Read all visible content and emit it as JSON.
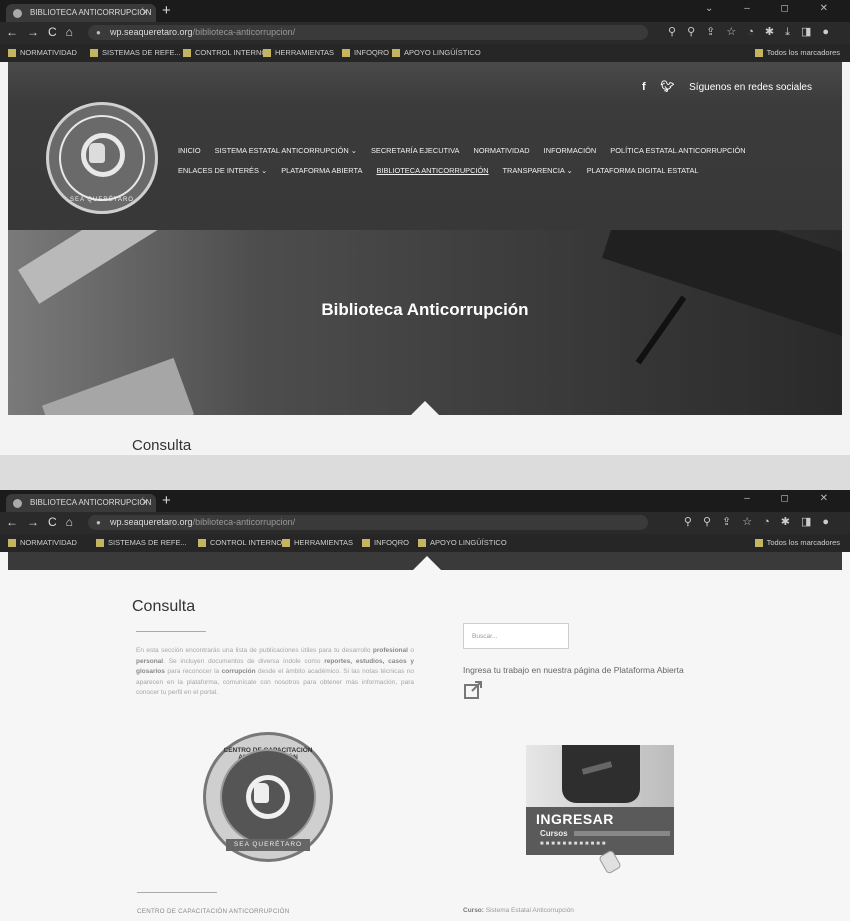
{
  "shot1": {
    "tab_title": "BIBLIOTECA ANTICORRUPCIÓN",
    "tab_close": "×",
    "new_tab": "+",
    "url_host": "wp.seaqueretaro.org",
    "url_path": "/biblioteca-anticorrupcion/",
    "bookmarks": [
      "NORMATIVIDAD",
      "SISTEMAS DE REFE...",
      "CONTROL INTERNO",
      "HERRAMIENTAS",
      "INFOQRO",
      "APOYO LINGÜÍSTICO"
    ],
    "bookmarks_all": "Todos los marcadores",
    "social_label": "Síguenos en redes sociales",
    "social_facebook": "f",
    "menu_row1": [
      "INICIO",
      "SISTEMA ESTATAL ANTICORRUPCIÓN ⌄",
      "SECRETARÍA EJECUTIVA",
      "NORMATIVIDAD",
      "INFORMACIÓN",
      "POLÍTICA ESTATAL ANTICORRUPCIÓN"
    ],
    "menu_row2": [
      "ENLACES DE INTERÉS ⌄",
      "PLATAFORMA ABIERTA",
      "BIBLIOTECA ANTICORRUPCIÓN",
      "TRANSPARENCIA ⌄",
      "PLATAFORMA DIGITAL ESTATAL"
    ],
    "logo_text_bottom": "SEA QUERÉTARO",
    "hero_title": "Biblioteca Anticorrupción",
    "section_heading": "Consulta"
  },
  "shot2": {
    "tab_title": "BIBLIOTECA ANTICORRUPCIÓN",
    "tab_close": "×",
    "new_tab": "+",
    "url_host": "wp.seaqueretaro.org",
    "url_path": "/biblioteca-anticorrupcion/",
    "bookmarks": [
      "NORMATIVIDAD",
      "SISTEMAS DE REFE...",
      "CONTROL INTERNO",
      "HERRAMIENTAS",
      "INFOQRO",
      "APOYO LINGÜÍSTICO"
    ],
    "bookmarks_all": "Todos los marcadores",
    "section_heading": "Consulta",
    "intro_p1": "En esta sección encontrarás una lista de publicaciones",
    "intro_b1": "publicaciones",
    "intro_p2": "útiles para tu desarrollo",
    "intro_b2": "profesional",
    "intro_p3": "o",
    "intro_b3": "personal",
    "intro_p4": ". Se incluyen documentos de diversa índole como",
    "intro_b4": "reportes, estudios, casos y glosarios",
    "intro_p5": "para reconocer la",
    "intro_b5": "corrupción",
    "intro_p6": "desde el ámbito académico. Si las notas técnicas no aparecen en la plataforma, comunícate con nosotros para obtener más información, para conocer tu perfil en el portal.",
    "search_placeholder": "Buscar...",
    "upload_text": "Ingresa tu trabajo en nuestra página de Plataforma Abierta",
    "cert_top_text": "CENTRO DE CAPACITACIÓN ANTICORRUPCIÓN",
    "cert_bottom_text": "SEA QUERÉTARO",
    "banner_ingresar": "INGRESAR",
    "banner_cursos": "Cursos",
    "caption_left": "CENTRO DE CAPACITACIÓN ANTICORRUPCIÓN",
    "caption_right_label": "Curso:",
    "caption_right_value": "Sistema Estatal Anticorrupción"
  }
}
